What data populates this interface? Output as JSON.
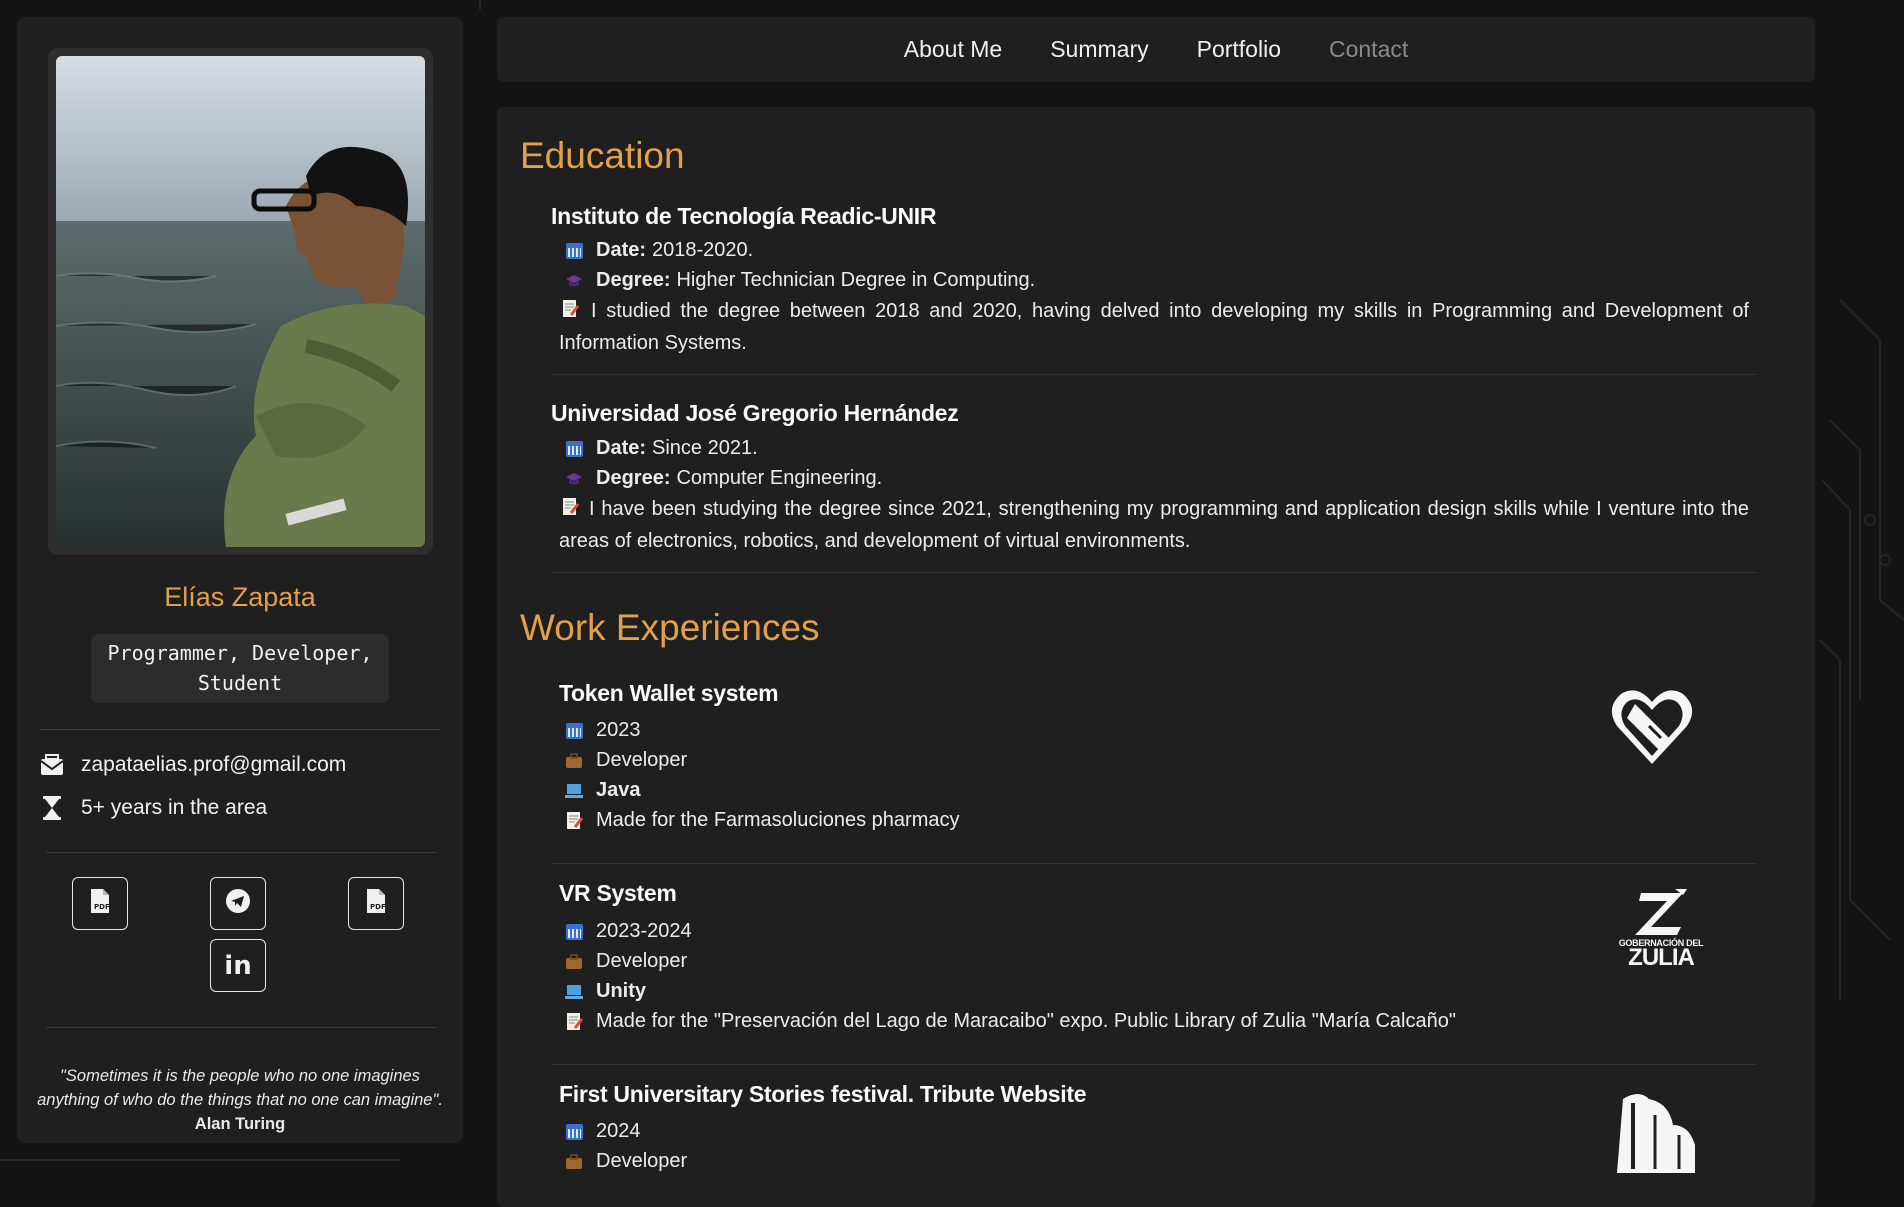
{
  "sidebar": {
    "name": "Elías Zapata",
    "roles_line1": "Programmer, Developer,",
    "roles_line2": "Student",
    "email": "zapataelias.prof@gmail.com",
    "experience": "5+ years in the area",
    "social": [
      "pdf-icon",
      "telegram-icon",
      "pdf-icon",
      "linkedin-icon"
    ],
    "quote": "\"Sometimes it is the people who no one imagines anything of who do the things that no one can imagine\".",
    "quote_author": "Alan Turing"
  },
  "nav": {
    "items": [
      "About Me",
      "Summary",
      "Portfolio",
      "Contact"
    ],
    "active": "Contact"
  },
  "education": {
    "heading": "Education",
    "items": [
      {
        "institution": "Instituto de Tecnología Readic-UNIR",
        "date_label": "Date:",
        "date": "2018-2020.",
        "degree_label": "Degree:",
        "degree": "Higher Technician Degree in Computing.",
        "description": "I studied the degree between 2018 and 2020, having delved into developing my skills in Programming and Development of Information Systems."
      },
      {
        "institution": "Universidad José Gregorio Hernández",
        "date_label": "Date:",
        "date": "Since 2021.",
        "degree_label": "Degree:",
        "degree": "Computer Engineering.",
        "description": "I have been studying the degree since 2021, strengthening my programming and application design skills while I venture into the areas of electronics, robotics, and development of virtual environments."
      }
    ]
  },
  "work": {
    "heading": "Work Experiences",
    "items": [
      {
        "title": "Token Wallet system",
        "year": "2023",
        "role": "Developer",
        "tech": "Java",
        "description": "Made for the Farmasoluciones pharmacy",
        "logo": "farmasoluciones-heart-logo"
      },
      {
        "title": "VR System",
        "year": "2023-2024",
        "role": "Developer",
        "tech": "Unity",
        "description": "Made for the \"Preservación del Lago de Maracaibo\" expo. Public Library of Zulia \"María Calcaño\"",
        "logo": "gobernacion-zulia-logo",
        "logo_text1": "GOBERNACIÓN DEL",
        "logo_text2": "ZULIA"
      },
      {
        "title": "First Universitary Stories festival. Tribute Website",
        "year": "2024",
        "role": "Developer",
        "logo": "university-book-logo"
      }
    ]
  },
  "colors": {
    "accent": "#e2a04a",
    "background": "#141414",
    "panel": "#1f1f1f"
  }
}
